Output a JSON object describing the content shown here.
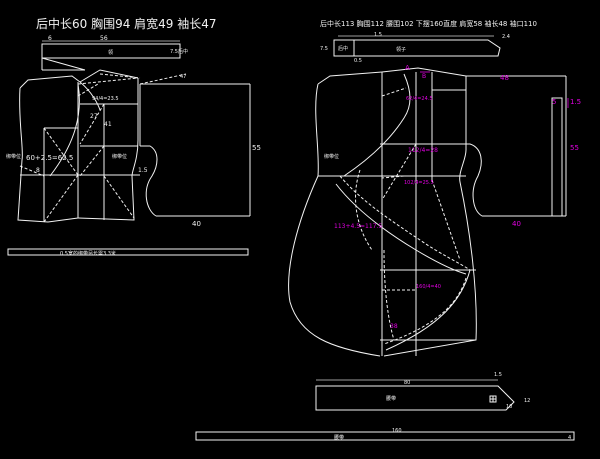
{
  "left_title": "后中长60   胸围94   肩宽49   袖长47",
  "right_title": "后中长113  胸围112  腰围102  下摆160直度  肩宽58  袖长48  袖口110",
  "left": {
    "collar_w": "6",
    "collar_len": "56",
    "collar_name": "领",
    "collar_h": "7.5",
    "collar_mid": "后中",
    "sleeve_angle": "47",
    "chest_calc": "94/4=23.5",
    "d27": "27",
    "d41": "41",
    "front_calc": "60+2.5=62.5",
    "d8": "8",
    "tie_left": "绑带位",
    "tie_right": "绑带位",
    "d55": "55",
    "d15": "1.5",
    "d40": "40",
    "tie_strip": "0.5宽的绑带另长需3.3米"
  },
  "right": {
    "collar_h": "7.5",
    "collar_mid": "后中",
    "collar_a": "0.5",
    "collar_b": "1.5",
    "collar_name": "领子",
    "collar_c": "2.4",
    "markA": "A",
    "markB": "B",
    "d48": "48",
    "d5": "5",
    "d15": "1.5",
    "d55": "55",
    "d40": "40",
    "calc1": "62/4=24.5",
    "calc2": "112/4=28",
    "calc3": "102/4=25.5",
    "calc4": "113+4.5=117.5",
    "calc5": "160/4=40",
    "tie_label": "绑带位",
    "d38": "38",
    "belt_w": "80",
    "belt_h": "1.5",
    "belt_name": "腰带",
    "belt_d": "10",
    "belt_e": "12",
    "hem_len": "160",
    "hem_name": "腰带",
    "hem_h": "4"
  }
}
